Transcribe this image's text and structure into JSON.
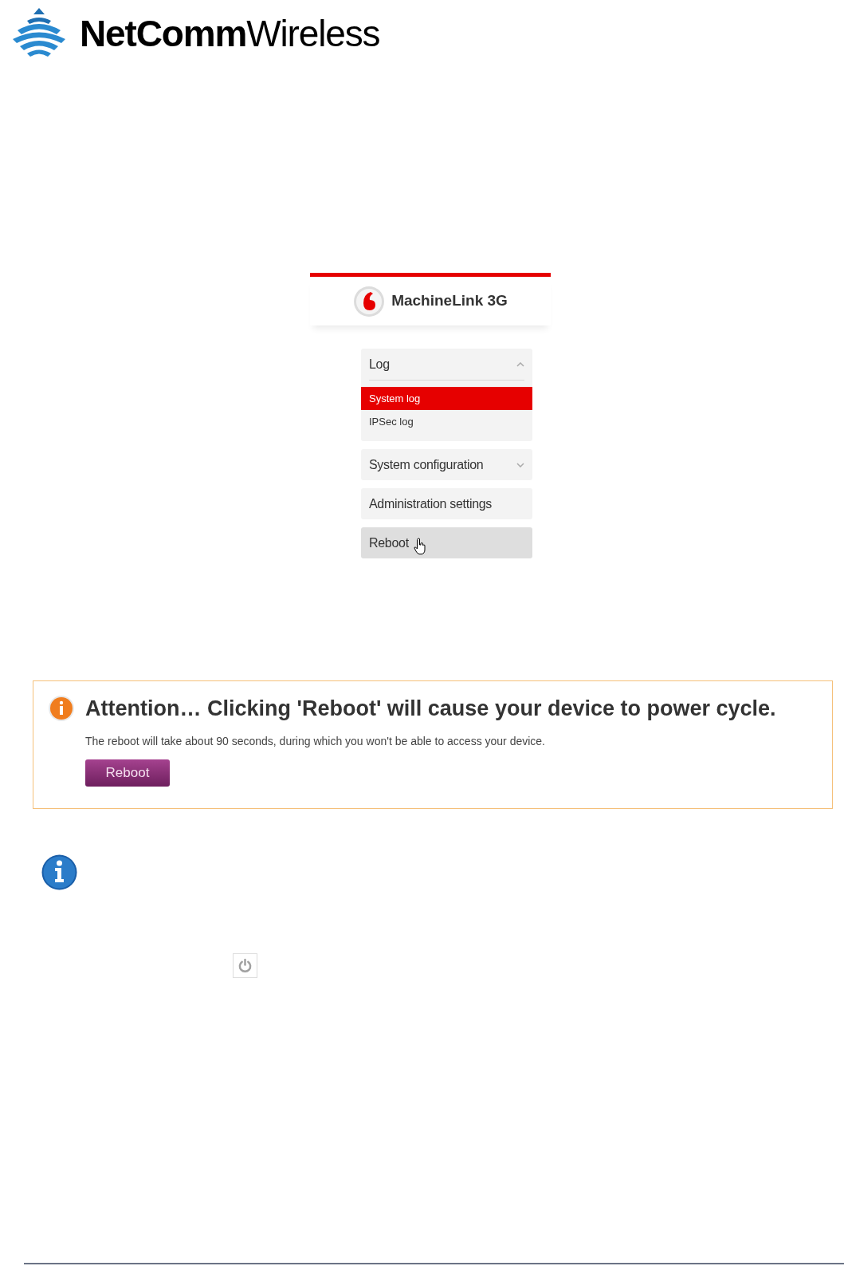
{
  "brand": {
    "logo_text": "**NetComm**Wireless"
  },
  "device_ui": {
    "product_name": "MachineLink 3G",
    "menu": [
      {
        "label": "Log",
        "kind": "group",
        "expanded": true,
        "hovered": false,
        "children": [
          {
            "label": "System log",
            "selected": true
          },
          {
            "label": "IPSec log",
            "selected": false
          }
        ]
      },
      {
        "label": "System configuration",
        "kind": "group",
        "expanded": false,
        "hovered": false
      },
      {
        "label": "Administration settings",
        "kind": "link",
        "hovered": false
      },
      {
        "label": "Reboot",
        "kind": "link",
        "hovered": true
      }
    ]
  },
  "attention": {
    "heading": "Attention… Clicking 'Reboot' will cause your device to power cycle.",
    "message": "The reboot will take about 90 seconds, during which you won't be able to access your device.",
    "button": "Reboot"
  }
}
